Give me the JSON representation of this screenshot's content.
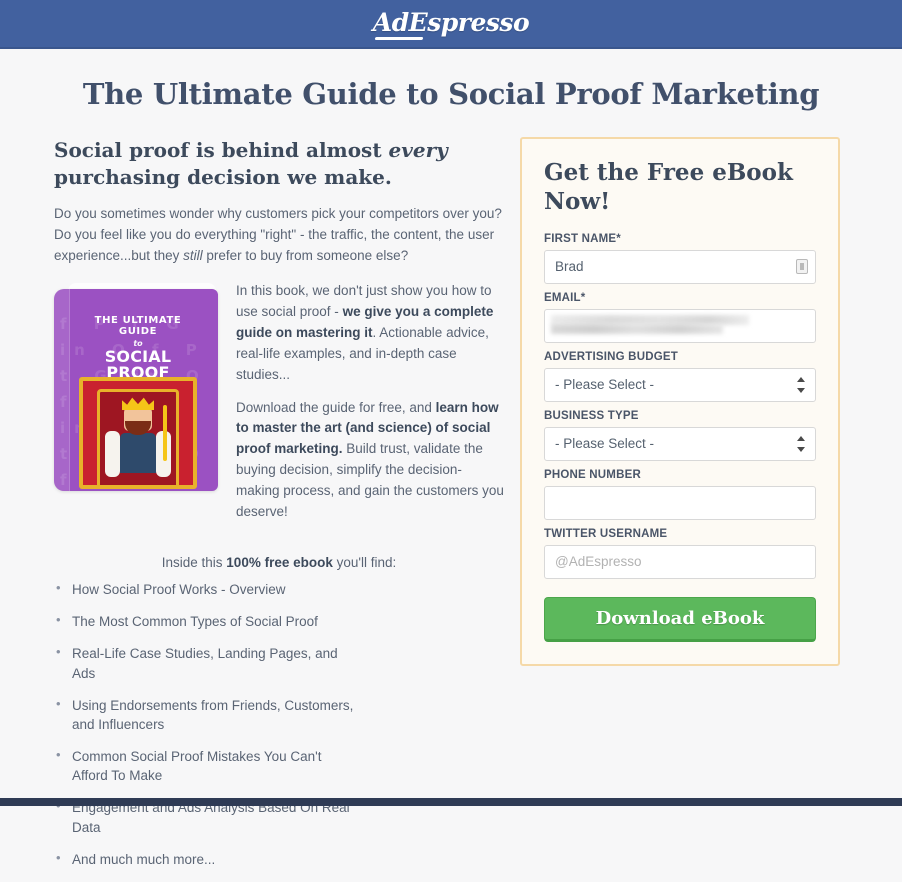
{
  "header": {
    "logo_text": "AdEspresso",
    "background_color": "#42619f"
  },
  "page_title": "The Ultimate Guide to Social Proof Marketing",
  "left": {
    "lede_part1": "Social proof is behind almost ",
    "lede_emphasis": "every",
    "lede_part2": " purchasing decision we make.",
    "intro_paragraph_part1": "Do you sometimes wonder why customers pick your competitors over you? Do you feel like you do everything \"right\" - the traffic, the content, the user experience...but they ",
    "intro_paragraph_emphasis": "still",
    "intro_paragraph_part2": " prefer to buy from someone else?",
    "book_cover": {
      "line1": "THE ULTIMATE GUIDE",
      "connector": "to",
      "line2": "SOCIAL PROOF MARKETING",
      "cover_color": "#9b51c2",
      "pattern_glyphs": "f P t G in O f P t G in O f P t G in O f P t G in O f P t G in O f P t G in O"
    },
    "body_p1_a": "In this book, we don't just show you how to use social proof - ",
    "body_p1_bold": "we give you a complete guide on mastering it",
    "body_p1_b": ". Actionable advice, real-life examples, and in-depth case studies...",
    "body_p2_a": "Download the guide for free, and ",
    "body_p2_bold": "learn how to master the art (and science) of social proof marketing.",
    "body_p2_b": " Build trust, validate the buying decision, simplify the decision-making process, and gain the customers you deserve!",
    "inside_a": "Inside this ",
    "inside_bold": "100% free ebook",
    "inside_b": " you'll find:",
    "features": [
      "How Social Proof Works - Overview",
      "The Most Common Types of Social Proof",
      "Real-Life Case Studies, Landing Pages, and Ads",
      "Using Endorsements from Friends, Customers, and Influencers",
      "Common Social Proof Mistakes You Can't Afford To Make",
      "Engagement and Ads Analysis Based On Real Data",
      "And much much more..."
    ]
  },
  "form": {
    "title": "Get the Free eBook Now!",
    "border_color": "#f5d9a8",
    "background_color": "#fdfaf4",
    "fields": {
      "first_name": {
        "label": "FIRST NAME*",
        "value": "Brad",
        "placeholder": ""
      },
      "email": {
        "label": "EMAIL*",
        "value": "",
        "placeholder": ""
      },
      "advertising_budget": {
        "label": "ADVERTISING BUDGET",
        "value": "- Please Select -",
        "options": [
          "- Please Select -"
        ]
      },
      "business_type": {
        "label": "BUSINESS TYPE",
        "value": "- Please Select -",
        "options": [
          "- Please Select -"
        ]
      },
      "phone_number": {
        "label": "PHONE NUMBER",
        "value": "",
        "placeholder": ""
      },
      "twitter_username": {
        "label": "TWITTER USERNAME",
        "value": "",
        "placeholder": "@AdEspresso"
      }
    },
    "submit_label": "Download eBook",
    "submit_color": "#5cb85c"
  }
}
